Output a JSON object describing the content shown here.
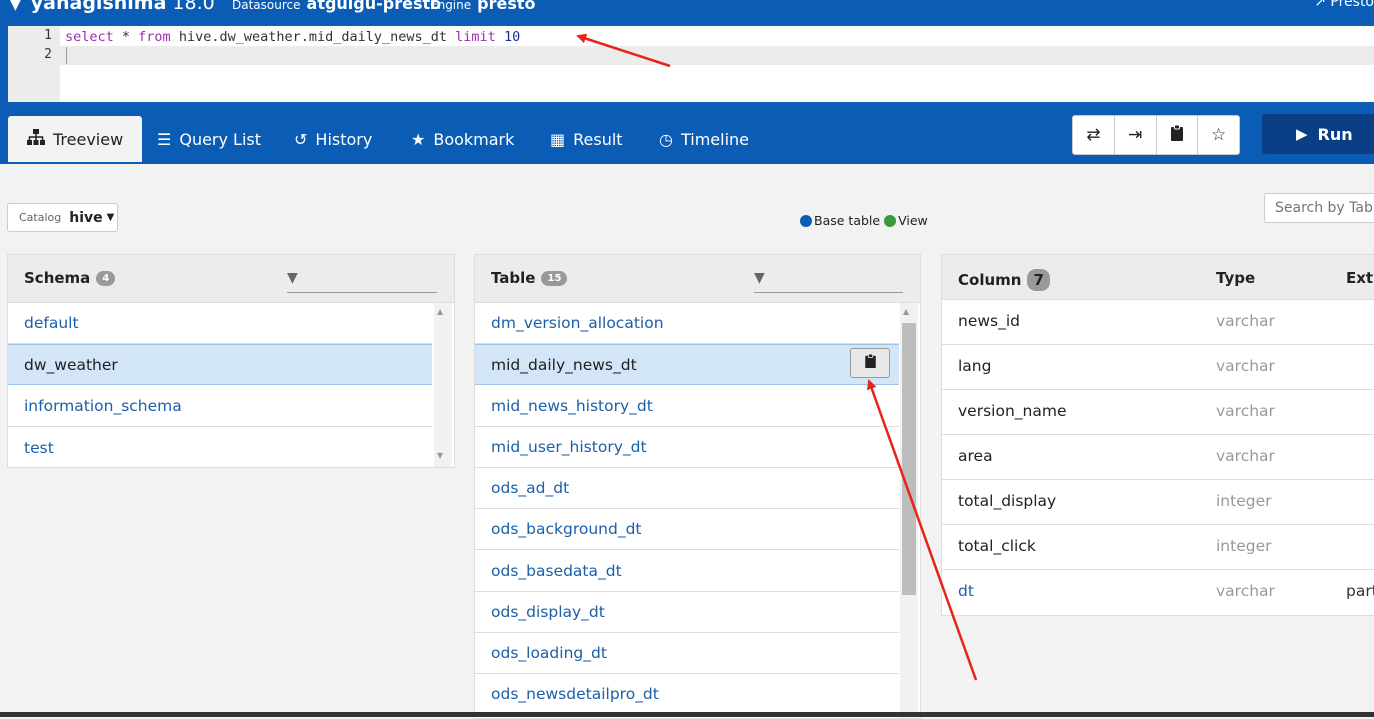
{
  "app": {
    "name": "yanagishima",
    "version": "18.0",
    "datasource_label": "Datasource",
    "datasource": "atguigu-presto",
    "engine_label": "Engine",
    "engine": "presto",
    "external_link": "Presto"
  },
  "editor": {
    "line_numbers": [
      "1",
      "2"
    ],
    "query": {
      "kw_select": "select",
      "star": " * ",
      "kw_from": "from",
      "table": " hive.dw_weather.mid_daily_news_dt ",
      "kw_limit": "limit",
      "limit_value": " 10"
    }
  },
  "tabs": [
    {
      "label": "Treeview",
      "icon": "sitemap-icon",
      "active": true
    },
    {
      "label": "Query List",
      "icon": "list-icon"
    },
    {
      "label": "History",
      "icon": "history-icon"
    },
    {
      "label": "Bookmark",
      "icon": "star-icon"
    },
    {
      "label": "Result",
      "icon": "table-icon"
    },
    {
      "label": "Timeline",
      "icon": "clock-icon"
    }
  ],
  "toolbar": {
    "buttons": [
      "exchange-icon",
      "indent-icon",
      "clipboard-icon",
      "star-outline-icon"
    ],
    "run_label": "Run"
  },
  "catalog": {
    "label": "Catalog",
    "value": "hive"
  },
  "legend": {
    "base_table": "Base table",
    "view": "View",
    "base_color": "#0b5cb5",
    "view_color": "#3a9a3a"
  },
  "search": {
    "placeholder": "Search by Table"
  },
  "schema_panel": {
    "title": "Schema",
    "count": "4",
    "items": [
      "default",
      "dw_weather",
      "information_schema",
      "test"
    ],
    "selected": "dw_weather"
  },
  "table_panel": {
    "title": "Table",
    "count": "15",
    "items": [
      "dm_version_allocation",
      "mid_daily_news_dt",
      "mid_news_history_dt",
      "mid_user_history_dt",
      "ods_ad_dt",
      "ods_background_dt",
      "ods_basedata_dt",
      "ods_display_dt",
      "ods_loading_dt",
      "ods_newsdetailpro_dt"
    ],
    "selected": "mid_daily_news_dt"
  },
  "column_panel": {
    "title": "Column",
    "count": "7",
    "headers": [
      "Column",
      "Type",
      "Extra"
    ],
    "rows": [
      {
        "name": "news_id",
        "type": "varchar",
        "extra": ""
      },
      {
        "name": "lang",
        "type": "varchar",
        "extra": ""
      },
      {
        "name": "version_name",
        "type": "varchar",
        "extra": ""
      },
      {
        "name": "area",
        "type": "varchar",
        "extra": ""
      },
      {
        "name": "total_display",
        "type": "integer",
        "extra": ""
      },
      {
        "name": "total_click",
        "type": "integer",
        "extra": ""
      },
      {
        "name": "dt",
        "type": "varchar",
        "extra": "partition key"
      }
    ]
  },
  "annotation_color": "#e8231b"
}
